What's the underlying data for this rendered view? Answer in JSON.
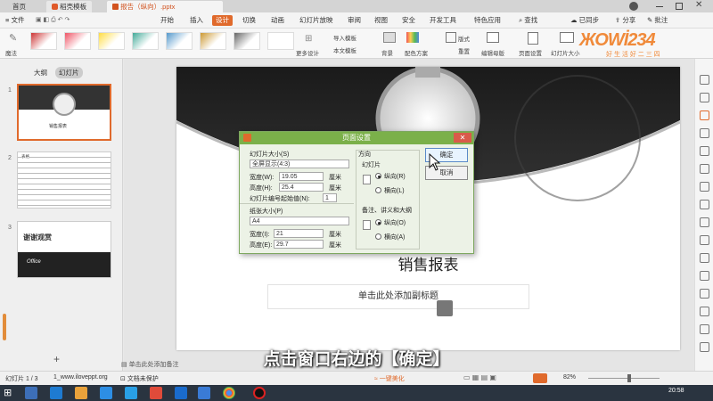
{
  "titlebar": {
    "tabs": [
      "首页",
      "稻壳模板",
      "报告（纵向）.pptx"
    ],
    "right_icons": [
      "user-avatar",
      "minimize",
      "maximize",
      "close"
    ]
  },
  "menubar": {
    "file": "文件",
    "items": [
      "开始",
      "插入",
      "设计",
      "切换",
      "动画",
      "幻灯片放映",
      "审阅",
      "视图",
      "安全",
      "开发工具",
      "特色应用"
    ],
    "active": "设计",
    "search": "查找",
    "sync": "已同步",
    "share": "分享",
    "comment": "批注"
  },
  "ribbon": {
    "magic": "魔法",
    "more_design": "更多设计",
    "import_template": "导入模板",
    "body_template": "本文模板",
    "background": "背景",
    "color_scheme": "配色方案",
    "layout": "版式",
    "redesign": "重置",
    "edit_master": "编辑母版",
    "page_setup": "页面设置",
    "slide_size": "幻灯片大小"
  },
  "watermark": {
    "brand": "ЖОWİ234",
    "tagline": "好 生 活 好 二 三 四"
  },
  "leftpane": {
    "tab_outline": "大纲",
    "tab_slides": "幻灯片",
    "slides": [
      {
        "num": "1",
        "title": "销售报表"
      },
      {
        "num": "2",
        "title": "表格"
      },
      {
        "num": "3",
        "title": "谢谢观赏",
        "sub": "Office"
      }
    ]
  },
  "slide": {
    "title": "销售报表",
    "subtitle_placeholder": "单击此处添加副标题"
  },
  "dialog": {
    "title": "页面设置",
    "slide_size_label": "幻灯片大小(S)",
    "slide_size_value": "全屏显示(4:3)",
    "width_label": "宽度(W):",
    "width_value": "19.05",
    "height_label": "高度(H):",
    "height_value": "25.4",
    "unit": "厘米",
    "start_num_label": "幻灯片编号起始值(N):",
    "start_num_value": "1",
    "paper_size_label": "纸张大小(P)",
    "paper_size_value": "A4",
    "pwidth_label": "宽度(I):",
    "pwidth_value": "21",
    "pheight_label": "高度(E):",
    "pheight_value": "29.7",
    "orientation_label": "方向",
    "slides_label": "幻灯片",
    "portrait": "纵向(R)",
    "landscape": "横向(L)",
    "notes_label": "备注、讲义和大纲",
    "notes_portrait": "纵向(O)",
    "notes_landscape": "横向(A)",
    "ok": "确定",
    "cancel": "取消"
  },
  "notes_placeholder": "单击此处添加备注",
  "caption": "点击窗口右边的【确定】",
  "statusbar": {
    "slide_count": "幻灯片 1 / 3",
    "theme": "1_www.iloveppt.org",
    "protect": "文档未保护",
    "beautify": "一键美化",
    "zoom": "82%"
  },
  "taskbar": {
    "time": "20:58"
  },
  "colors": {
    "dialog_title": "#7bb04a",
    "active_tab": "#e06a2c",
    "orange": "#f08a3a"
  }
}
